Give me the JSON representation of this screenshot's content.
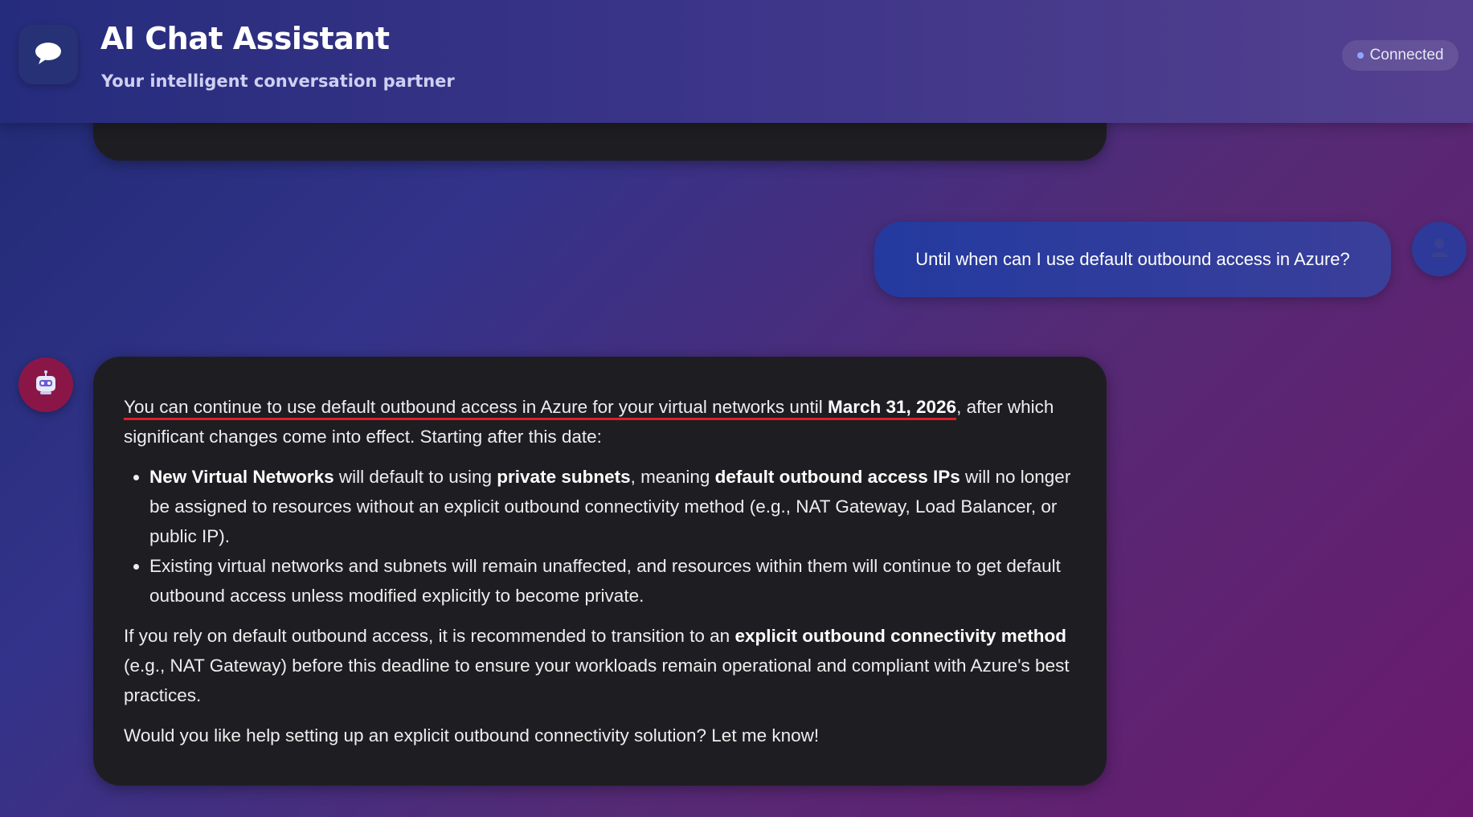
{
  "header": {
    "title": "AI Chat Assistant",
    "subtitle": "Your intelligent conversation partner",
    "logo_icon": "chat-bubble-icon",
    "status": "Connected",
    "status_color": "#8ea6ff"
  },
  "user_message": {
    "text": "Until when can I use default outbound access in Azure?",
    "avatar_icon": "user-icon"
  },
  "assistant_message": {
    "avatar_icon": "robot-icon",
    "intro_highlight": "You can continue to use default outbound access in Azure for your virtual networks until ",
    "intro_date": "March 31, 2026",
    "intro_rest": ", after which significant changes come into effect. Starting after this date:",
    "bullet1_b1": "New Virtual Networks",
    "bullet1_t1": " will default to using ",
    "bullet1_b2": "private subnets",
    "bullet1_t2": ", meaning ",
    "bullet1_b3": "default outbound access IPs",
    "bullet1_t3": " will no longer be assigned to resources without an explicit outbound connectivity method (e.g., NAT Gateway, Load Balancer, or public IP).",
    "bullet2": "Existing virtual networks and subnets will remain unaffected, and resources within them will continue to get default outbound access unless modified explicitly to become private.",
    "para2_t1": "If you rely on default outbound access, it is recommended to transition to an ",
    "para2_b1": "explicit outbound connectivity method",
    "para2_t2": " (e.g., NAT Gateway) before this deadline to ensure your workloads remain operational and compliant with Azure's best practices.",
    "para3": "Would you like help setting up an explicit outbound connectivity solution? Let me know!"
  },
  "colors": {
    "bubble_bg": "#1e1e22",
    "user_bubble": "#2b3da0",
    "bot_avatar": "#8a1648",
    "highlight_underline": "#e0202b"
  }
}
